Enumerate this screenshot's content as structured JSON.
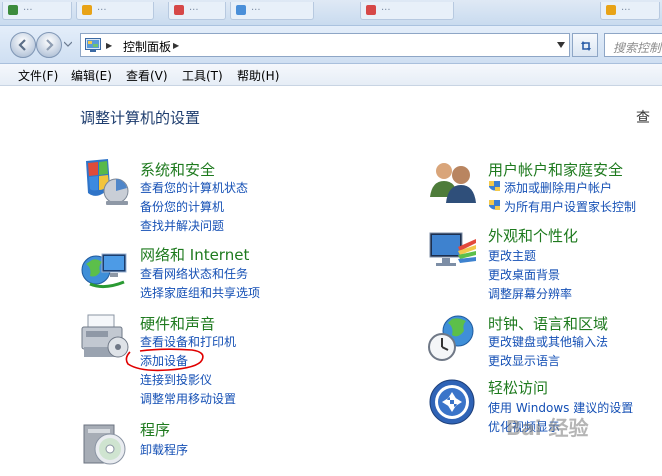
{
  "tabs": [
    {
      "label": "...",
      "color": "#3d8c3d"
    },
    {
      "label": "...",
      "color": "#e8a317"
    },
    {
      "label": "...",
      "color": "#d64848"
    },
    {
      "label": "...",
      "color": "#4a8fd9"
    },
    {
      "label": "...",
      "color": "#d64848"
    },
    {
      "label": "...",
      "color": "#e8a317"
    }
  ],
  "address": {
    "crumb": "控制面板",
    "search_placeholder": "搜索控制面"
  },
  "menu": {
    "file": "文件(F)",
    "edit": "编辑(E)",
    "view": "查看(V)",
    "tools": "工具(T)",
    "help": "帮助(H)"
  },
  "page": {
    "title": "调整计算机的设置",
    "view_mode": "查"
  },
  "categories": {
    "system": {
      "title": "系统和安全",
      "links": [
        "查看您的计算机状态",
        "备份您的计算机",
        "查找并解决问题"
      ]
    },
    "network": {
      "title": "网络和 Internet",
      "links": [
        "查看网络状态和任务",
        "选择家庭组和共享选项"
      ]
    },
    "hardware": {
      "title": "硬件和声音",
      "links": [
        "查看设备和打印机",
        "添加设备",
        "连接到投影仪",
        "调整常用移动设置"
      ]
    },
    "programs": {
      "title": "程序",
      "links": [
        "卸载程序"
      ]
    },
    "users": {
      "title": "用户帐户和家庭安全",
      "links": [
        "添加或删除用户帐户",
        "为所有用户设置家长控制"
      ]
    },
    "appearance": {
      "title": "外观和个性化",
      "links": [
        "更改主题",
        "更改桌面背景",
        "调整屏幕分辨率"
      ]
    },
    "clock": {
      "title": "时钟、语言和区域",
      "links": [
        "更改键盘或其他输入法",
        "更改显示语言"
      ]
    },
    "ease": {
      "title": "轻松访问",
      "links": [
        "使用 Windows 建议的设置",
        "优化视频显示"
      ]
    }
  },
  "watermark": "Bai 经验",
  "colors": {
    "category_title": "#1e7a1e",
    "link": "#1550b5",
    "page_title": "#1e3d6e",
    "annotation": "#e00000"
  }
}
